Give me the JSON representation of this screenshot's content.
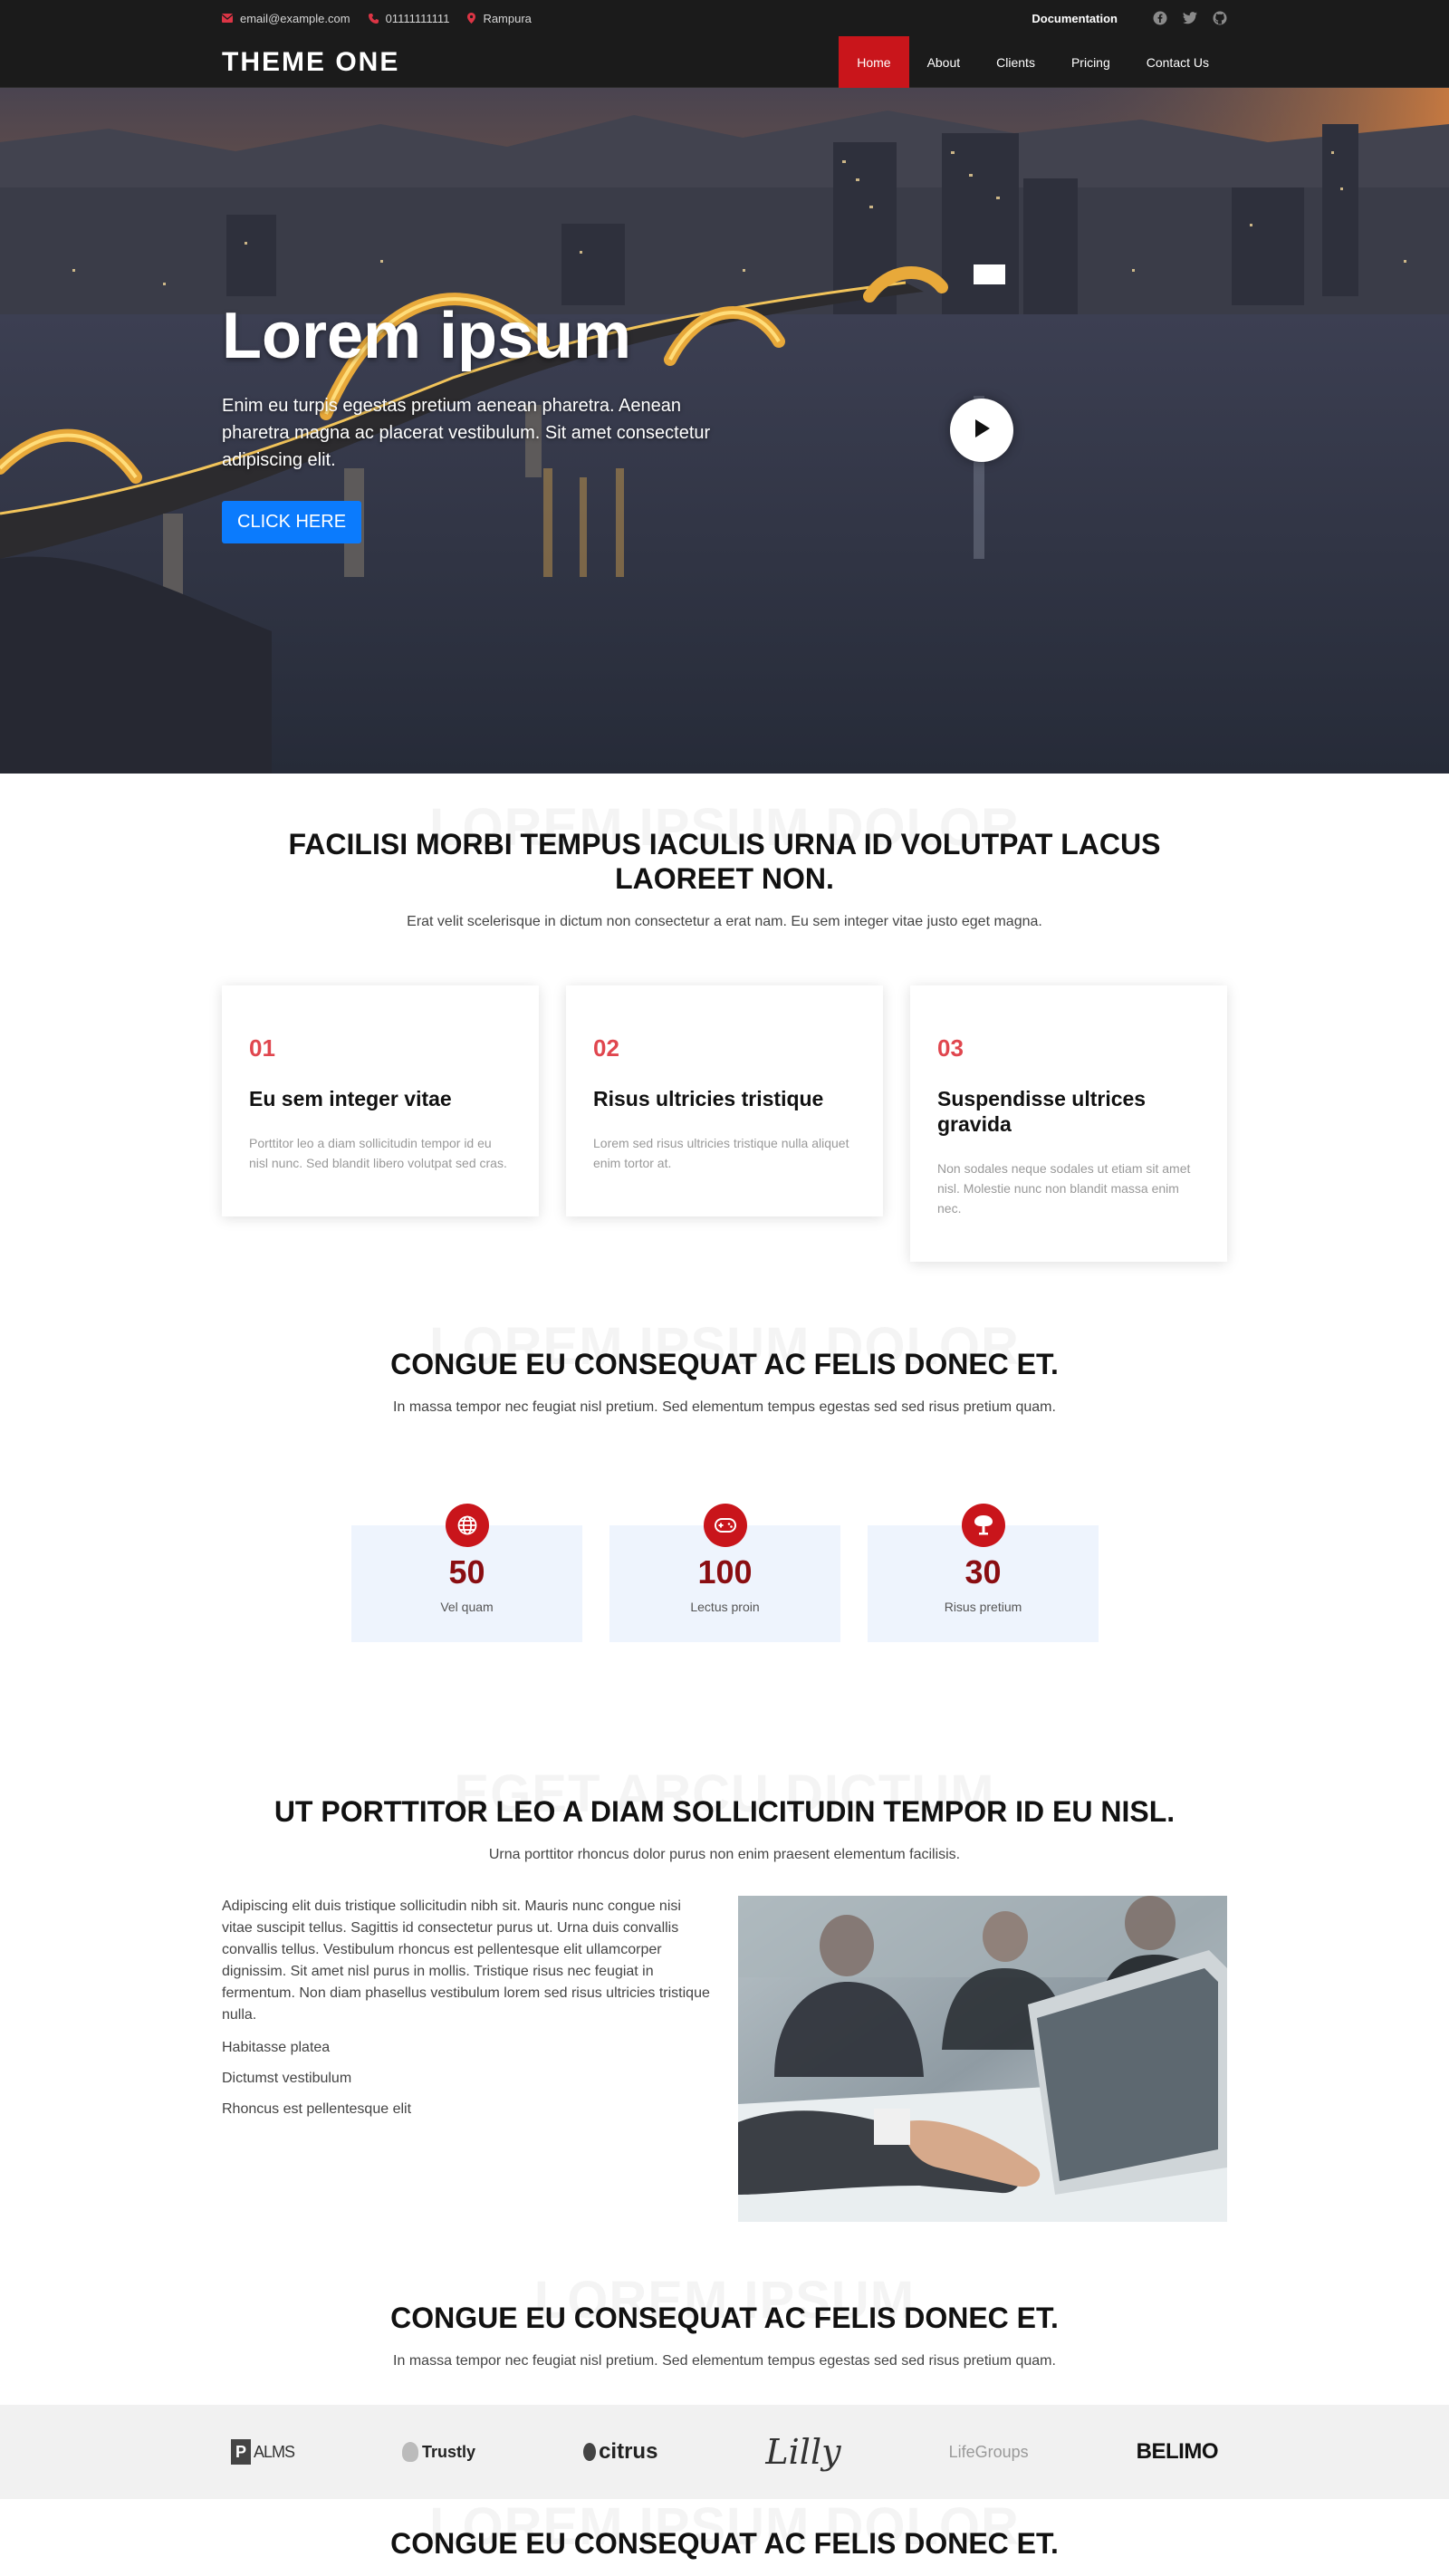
{
  "topbar": {
    "email": "email@example.com",
    "phone": "01111111111",
    "location": "Rampura",
    "documentation": "Documentation",
    "social": [
      "facebook-icon",
      "twitter-icon",
      "github-icon"
    ]
  },
  "nav": {
    "brand": "THEME ONE",
    "items": [
      "Home",
      "About",
      "Clients",
      "Pricing",
      "Contact Us"
    ],
    "active": "Home"
  },
  "hero": {
    "title": "Lorem ipsum",
    "text": "Enim eu turpis egestas pretium aenean pharetra. Aenean pharetra magna ac placerat vestibulum. Sit amet consectetur adipiscing elit.",
    "button": "CLICK HERE"
  },
  "features": {
    "bg_text": "LOREM IPSUM DOLOR",
    "title": "FACILISI MORBI TEMPUS IACULIS URNA ID VOLUTPAT LACUS LAOREET NON.",
    "subtitle": "Erat velit scelerisque in dictum non consectetur a erat nam. Eu sem integer vitae justo eget magna.",
    "cards": [
      {
        "num": "01",
        "title": "Eu sem integer vitae",
        "text": "Porttitor leo a diam sollicitudin tempor id eu nisl nunc. Sed blandit libero volutpat sed cras."
      },
      {
        "num": "02",
        "title": "Risus ultricies tristique",
        "text": "Lorem sed risus ultricies tristique nulla aliquet enim tortor at."
      },
      {
        "num": "03",
        "title": "Suspendisse ultrices gravida",
        "text": "Non sodales neque sodales ut etiam sit amet nisl. Molestie nunc non blandit massa enim nec."
      }
    ]
  },
  "stats": {
    "bg_text": "LOREM IPSUM DOLOR",
    "title": "CONGUE EU CONSEQUAT AC FELIS DONEC ET.",
    "subtitle": "In massa tempor nec feugiat nisl pretium. Sed elementum tempus egestas sed sed risus pretium quam.",
    "items": [
      {
        "num": "50",
        "label": "Vel quam",
        "icon": "globe-icon"
      },
      {
        "num": "100",
        "label": "Lectus proin",
        "icon": "gamepad-icon"
      },
      {
        "num": "30",
        "label": "Risus pretium",
        "icon": "tree-icon"
      }
    ]
  },
  "about": {
    "bg_text": "EGET ARCU DICTUM",
    "title": "UT PORTTITOR LEO A DIAM SOLLICITUDIN TEMPOR ID EU NISL.",
    "subtitle": "Urna porttitor rhoncus dolor purus non enim praesent elementum facilisis.",
    "paragraph": "Adipiscing elit duis tristique sollicitudin nibh sit. Mauris nunc congue nisi vitae suscipit tellus. Sagittis id consectetur purus ut. Urna duis convallis convallis tellus. Vestibulum rhoncus est pellentesque elit ullamcorper dignissim. Sit amet nisl purus in mollis. Tristique risus nec feugiat in fermentum. Non diam phasellus vestibulum lorem sed risus ultricies tristique nulla.",
    "list": [
      "Habitasse platea",
      "Dictumst vestibulum",
      "Rhoncus est pellentesque elit"
    ]
  },
  "clients": {
    "bg_text": "LOREM IPSUM",
    "title": "CONGUE EU CONSEQUAT AC FELIS DONEC ET.",
    "subtitle": "In massa tempor nec feugiat nisl pretium. Sed elementum tempus egestas sed sed risus pretium quam.",
    "logos": [
      "ALMS",
      "Trustly",
      "citrus",
      "Lilly",
      "LifeGroups",
      "BELIMO"
    ]
  },
  "next_section": {
    "bg_text": "LOREM IPSUM DOLOR",
    "title": "CONGUE EU CONSEQUAT AC FELIS DONEC ET."
  },
  "colors": {
    "accent_red": "#c9151b",
    "card_number_red": "#e0464e",
    "button_blue": "#0b7bfd",
    "dark_bar": "#1b1b1b",
    "stat_bg": "#eef4fd"
  }
}
